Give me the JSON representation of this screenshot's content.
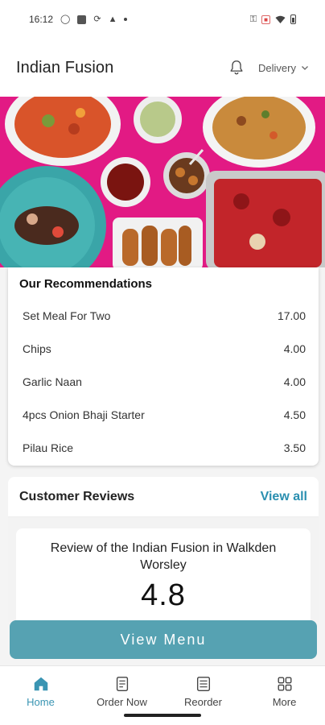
{
  "status_bar": {
    "time": "16:12"
  },
  "header": {
    "title": "Indian Fusion",
    "delivery_label": "Delivery"
  },
  "recommendations": {
    "title": "Our Recommendations",
    "items": [
      {
        "name": "Set Meal For Two",
        "price": "17.00"
      },
      {
        "name": "Chips",
        "price": "4.00"
      },
      {
        "name": "Garlic Naan",
        "price": "4.00"
      },
      {
        "name": "4pcs Onion Bhaji Starter",
        "price": "4.50"
      },
      {
        "name": "Pilau Rice",
        "price": "3.50"
      }
    ]
  },
  "reviews": {
    "title": "Customer Reviews",
    "view_all": "View all",
    "review_heading": "Review of the Indian Fusion in Walkden Worsley",
    "score": "4.8"
  },
  "view_menu_label": "View Menu",
  "bottom_nav": [
    {
      "label": "Home",
      "icon": "home-icon",
      "active": true
    },
    {
      "label": "Order Now",
      "icon": "order-icon",
      "active": false
    },
    {
      "label": "Reorder",
      "icon": "reorder-icon",
      "active": false
    },
    {
      "label": "More",
      "icon": "grid-icon",
      "active": false
    }
  ],
  "colors": {
    "accent": "#56a2b2",
    "link": "#2a8fb0",
    "hero_background": "#e21a84"
  }
}
